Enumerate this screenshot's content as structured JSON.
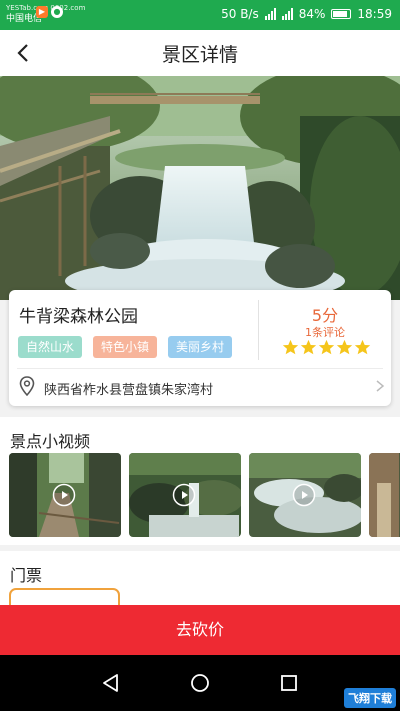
{
  "status_bar": {
    "site_text": "YESTab.com 0002.com",
    "carrier": "中国电信",
    "network_speed": "50 B/s",
    "network_type": "4G",
    "battery": "84%",
    "time": "18:59"
  },
  "header": {
    "title": "景区详情"
  },
  "spot": {
    "name": "牛背梁森林公园",
    "tags": [
      "自然山水",
      "特色小镇",
      "美丽乡村"
    ],
    "score": "5分",
    "review_count": "1条评论",
    "rating": 5,
    "address": "陕西省柞水县营盘镇朱家湾村"
  },
  "videos": {
    "title": "景点小视频",
    "count_visible": 4
  },
  "tickets": {
    "title": "门票"
  },
  "bargain_button": {
    "label": "去砍价"
  },
  "watermark": {
    "text": "飞翔下载"
  },
  "colors": {
    "status_bar": "#1faa4f",
    "accent_red": "#ee2a33",
    "score_orange": "#e8683a",
    "star_yellow": "#f5c51b",
    "tag_green": "#9bdccc",
    "tag_orange": "#f7b49a",
    "tag_blue": "#97ccef"
  }
}
